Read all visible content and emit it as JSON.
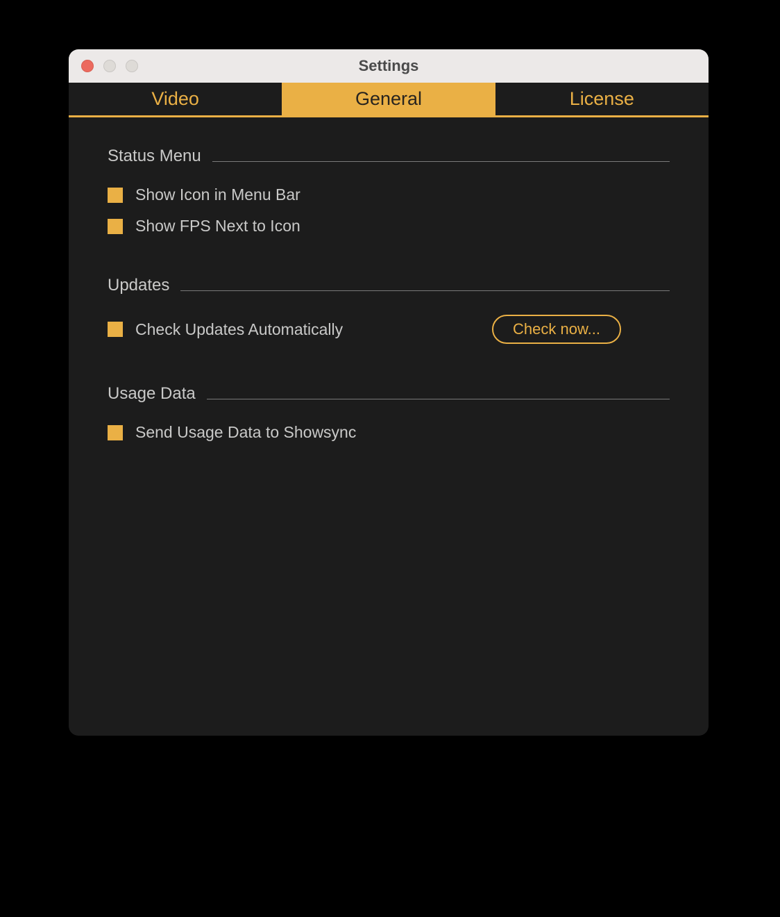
{
  "window": {
    "title": "Settings"
  },
  "tabs": {
    "video": "Video",
    "general": "General",
    "license": "License",
    "active": "general"
  },
  "sections": {
    "statusMenu": {
      "title": "Status Menu",
      "items": {
        "showIcon": {
          "label": "Show Icon in Menu Bar",
          "checked": true
        },
        "showFps": {
          "label": "Show FPS Next to Icon",
          "checked": true
        }
      }
    },
    "updates": {
      "title": "Updates",
      "items": {
        "autoCheck": {
          "label": "Check Updates Automatically",
          "checked": true
        }
      },
      "checkNowLabel": "Check now..."
    },
    "usageData": {
      "title": "Usage Data",
      "items": {
        "sendUsage": {
          "label": "Send Usage Data to Showsync",
          "checked": true
        }
      }
    }
  },
  "colors": {
    "accent": "#eab045",
    "windowBg": "#1c1c1c",
    "titlebarBg": "#ece9e8",
    "text": "#c9c9c8"
  }
}
